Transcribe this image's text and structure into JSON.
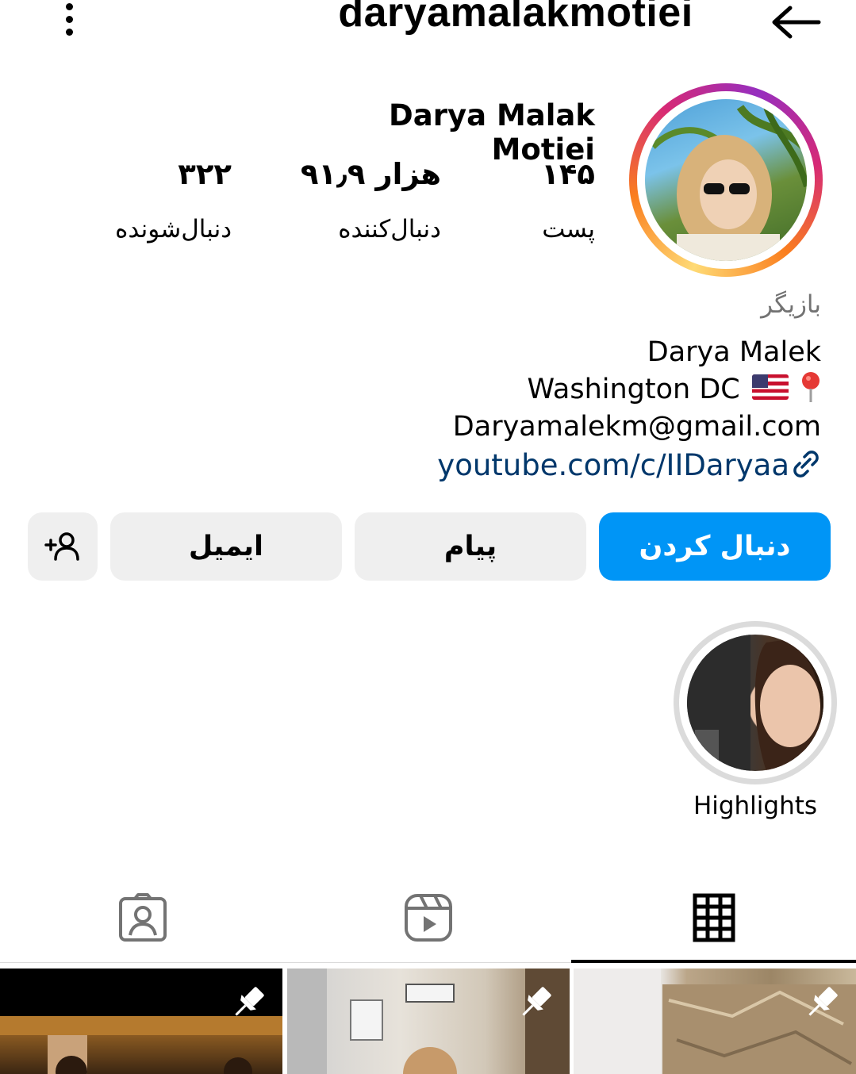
{
  "header": {
    "username": "daryamalakmotiei",
    "menu_icon": "more-vertical-icon",
    "back_icon": "arrow-left-icon"
  },
  "profile": {
    "display_name": "Darya Malak Motiei",
    "stats": {
      "posts": {
        "value": "۱۴۵",
        "label": "پست"
      },
      "followers": {
        "value": "۹۱٫۹ هزار",
        "label": "دنبال‌کننده"
      },
      "following": {
        "value": "۳۲۲",
        "label": "دنبال‌شونده"
      }
    },
    "avatar_ring_colors": [
      "#feda75",
      "#fa7e1e",
      "#d62976",
      "#962fbf"
    ]
  },
  "bio": {
    "category": "بازیگر",
    "line1": "Darya Malek",
    "line2": "Washington DC",
    "line3": "Daryamalekm@gmail.com",
    "link": "youtube.com/c/IIDaryaa"
  },
  "actions": {
    "follow": "دنبال کردن",
    "message": "پیام",
    "email": "ایمیل",
    "add_user_icon": "add-user-icon",
    "follow_color": "#0095f6"
  },
  "highlights": [
    {
      "label": "Highlights"
    }
  ],
  "tabs": [
    {
      "icon": "grid-icon",
      "active": true
    },
    {
      "icon": "reels-icon",
      "active": false
    },
    {
      "icon": "tagged-icon",
      "active": false
    }
  ],
  "posts": [
    {
      "pinned": true
    },
    {
      "pinned": true
    },
    {
      "pinned": true
    }
  ]
}
